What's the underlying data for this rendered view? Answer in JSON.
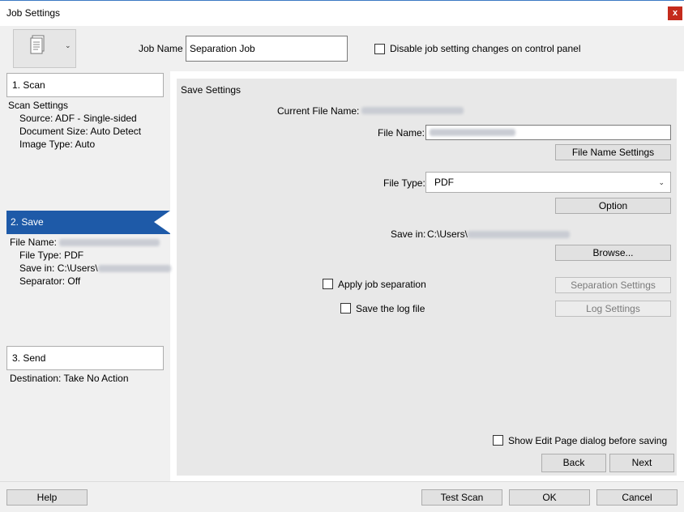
{
  "window": {
    "title": "Job Settings",
    "close_glyph": "x"
  },
  "header": {
    "job_name_label": "Job Name",
    "job_name_value": "Separation Job",
    "disable_label": "Disable job setting changes on control panel"
  },
  "steps": {
    "scan": {
      "label": "1. Scan",
      "heading": "Scan Settings",
      "source": "Source: ADF - Single-sided",
      "document_size": "Document Size: Auto Detect",
      "image_type": "Image Type: Auto"
    },
    "save": {
      "label": "2. Save",
      "file_name_label": "File Name:",
      "file_type": "File Type: PDF",
      "save_in_label": "Save in:",
      "save_in_prefix": "C:\\Users\\",
      "separator": "Separator: Off"
    },
    "send": {
      "label": "3. Send",
      "destination": "Destination: Take No Action"
    }
  },
  "save_settings": {
    "heading": "Save Settings",
    "current_file_name_label": "Current File Name:",
    "file_name_label": "File Name:",
    "file_name_settings_button": "File Name Settings",
    "file_type_label": "File Type:",
    "file_type_value": "PDF",
    "option_button": "Option",
    "save_in_label": "Save in:",
    "save_in_prefix": "C:\\Users\\",
    "browse_button": "Browse...",
    "apply_separation_label": "Apply job separation",
    "separation_settings_button": "Separation Settings",
    "save_log_label": "Save the log file",
    "log_settings_button": "Log Settings",
    "show_edit_page_label": "Show Edit Page dialog before saving",
    "back_button": "Back",
    "next_button": "Next"
  },
  "footer": {
    "help_button": "Help",
    "test_scan_button": "Test Scan",
    "ok_button": "OK",
    "cancel_button": "Cancel"
  },
  "colors": {
    "accent": "#1e5aa8",
    "close": "#c42b1c",
    "panel": "#e8e8e8"
  }
}
